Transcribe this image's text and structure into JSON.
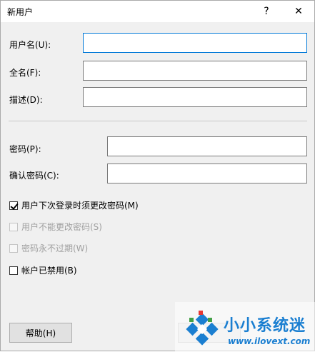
{
  "window": {
    "title": "新用户",
    "help_glyph": "?",
    "close_glyph": "✕"
  },
  "fields": {
    "username_label": "用户名(U):",
    "fullname_label": "全名(F):",
    "description_label": "描述(D):",
    "password_label": "密码(P):",
    "confirm_label": "确认密码(C):"
  },
  "options": [
    {
      "label": "用户下次登录时须更改密码(M)",
      "checked": true,
      "disabled": false
    },
    {
      "label": "用户不能更改密码(S)",
      "checked": false,
      "disabled": true
    },
    {
      "label": "密码永不过期(W)",
      "checked": false,
      "disabled": true
    },
    {
      "label": "帐户已禁用(B)",
      "checked": false,
      "disabled": false
    }
  ],
  "buttons": {
    "help": "帮助(H)"
  },
  "watermark": {
    "brand": "小小系统迷",
    "url": "www.ilovext.com"
  },
  "colors": {
    "focus_border": "#0078d7",
    "watermark": "#1b7fd1"
  }
}
